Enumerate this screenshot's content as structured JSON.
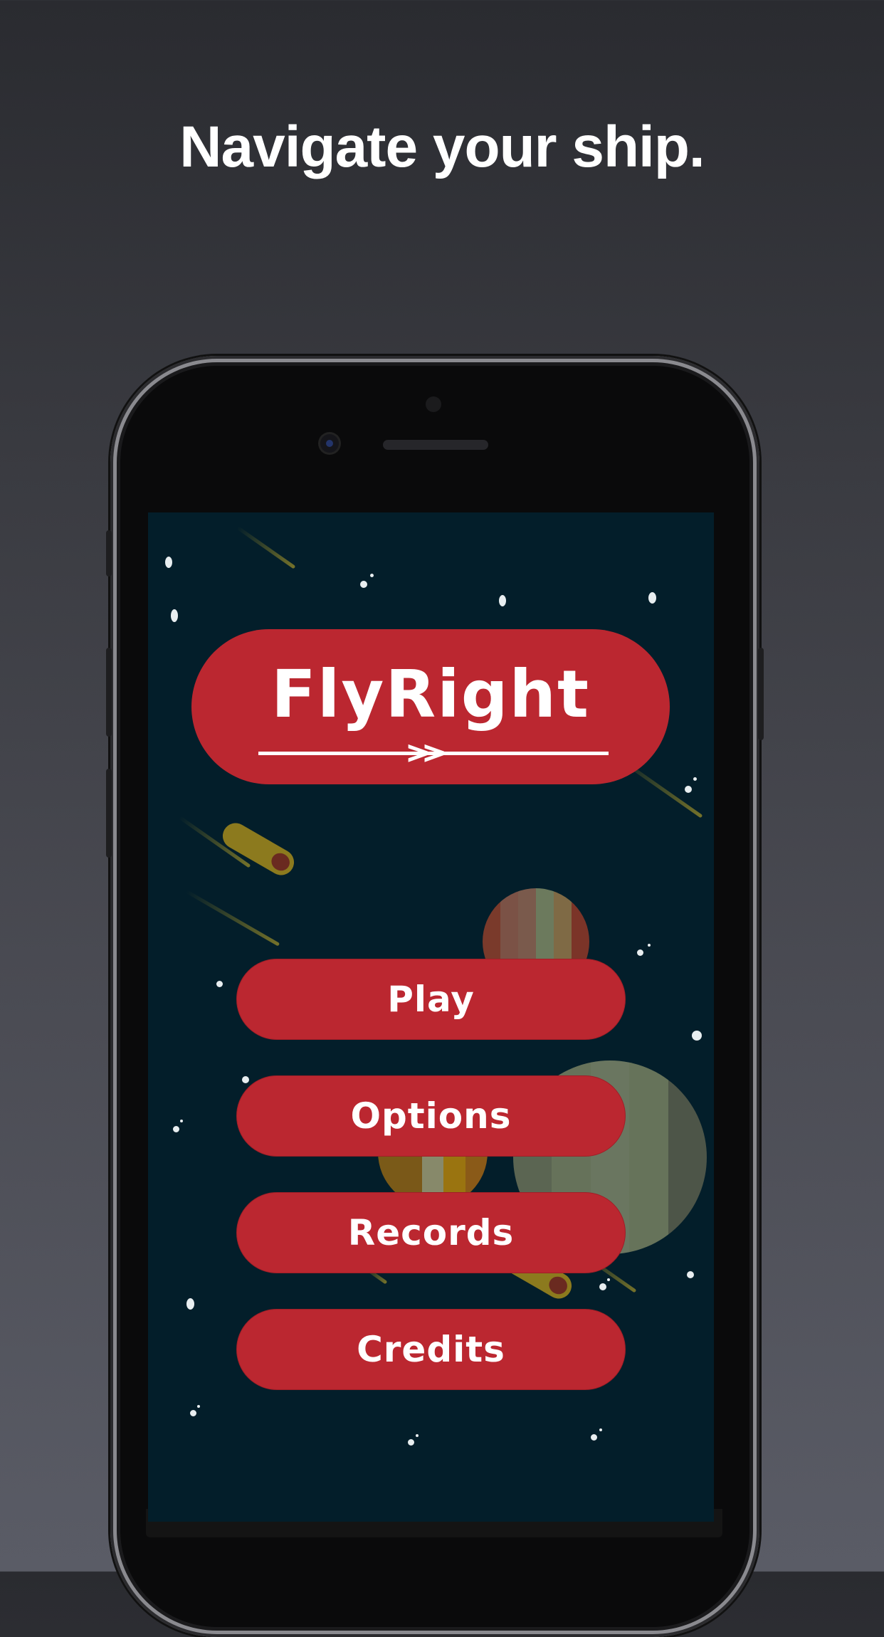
{
  "headline": "Navigate your ship.",
  "app": {
    "logo_text": "FlyRight",
    "logo_arrows": "»",
    "menu": [
      {
        "label": "Play"
      },
      {
        "label": "Options"
      },
      {
        "label": "Records"
      },
      {
        "label": "Credits"
      }
    ],
    "colors": {
      "background": "#031e2a",
      "button": "#bb2730",
      "text": "#ffffff"
    }
  }
}
